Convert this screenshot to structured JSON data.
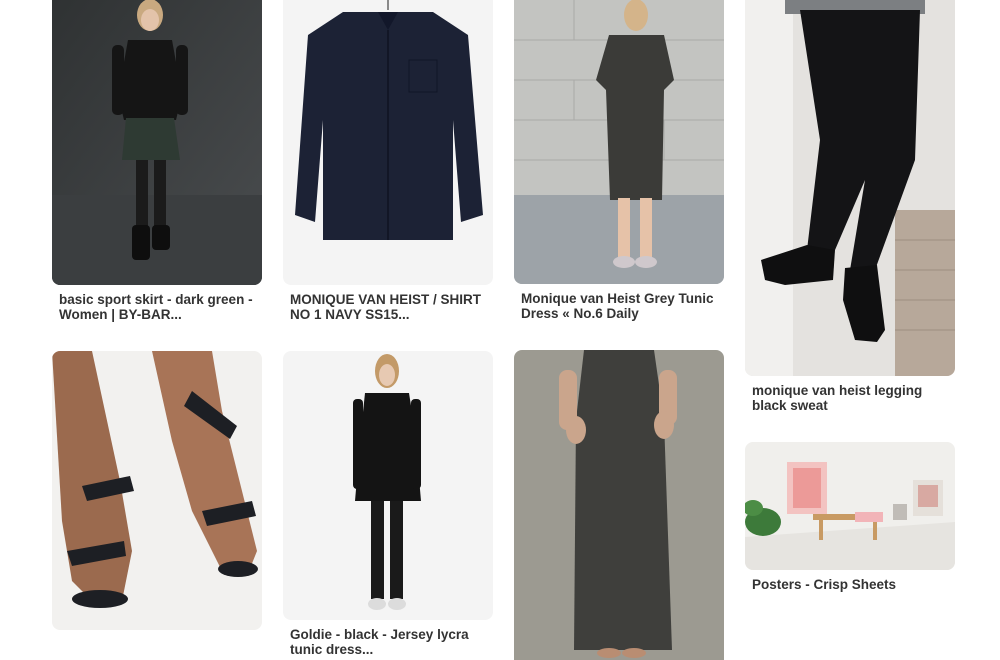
{
  "pins": [
    {
      "title": "basic sport skirt - dark green - Women | BY-BAR...",
      "image": "photo-model-black-top-leather-skirt"
    },
    {
      "title": "MONIQUE VAN HEIST / SHIRT NO 1 NAVY SS15...",
      "image": "photo-navy-shirt-on-hanger"
    },
    {
      "title": "Monique van Heist Grey Tunic Dress « No.6 Daily",
      "image": "photo-woman-grey-tunic-street"
    },
    {
      "title": "monique van heist legging black sweat",
      "image": "photo-black-leggings-ankle-boots"
    },
    {
      "title": "",
      "image": "photo-feet-black-leather-sandals"
    },
    {
      "title": "Goldie - black - Jersey lycra tunic dress...",
      "image": "photo-model-black-tunic-dress"
    },
    {
      "title": "",
      "image": "photo-woman-long-grey-skirt"
    },
    {
      "title": "Posters - Crisp Sheets",
      "image": "photo-room-pink-posters"
    }
  ]
}
